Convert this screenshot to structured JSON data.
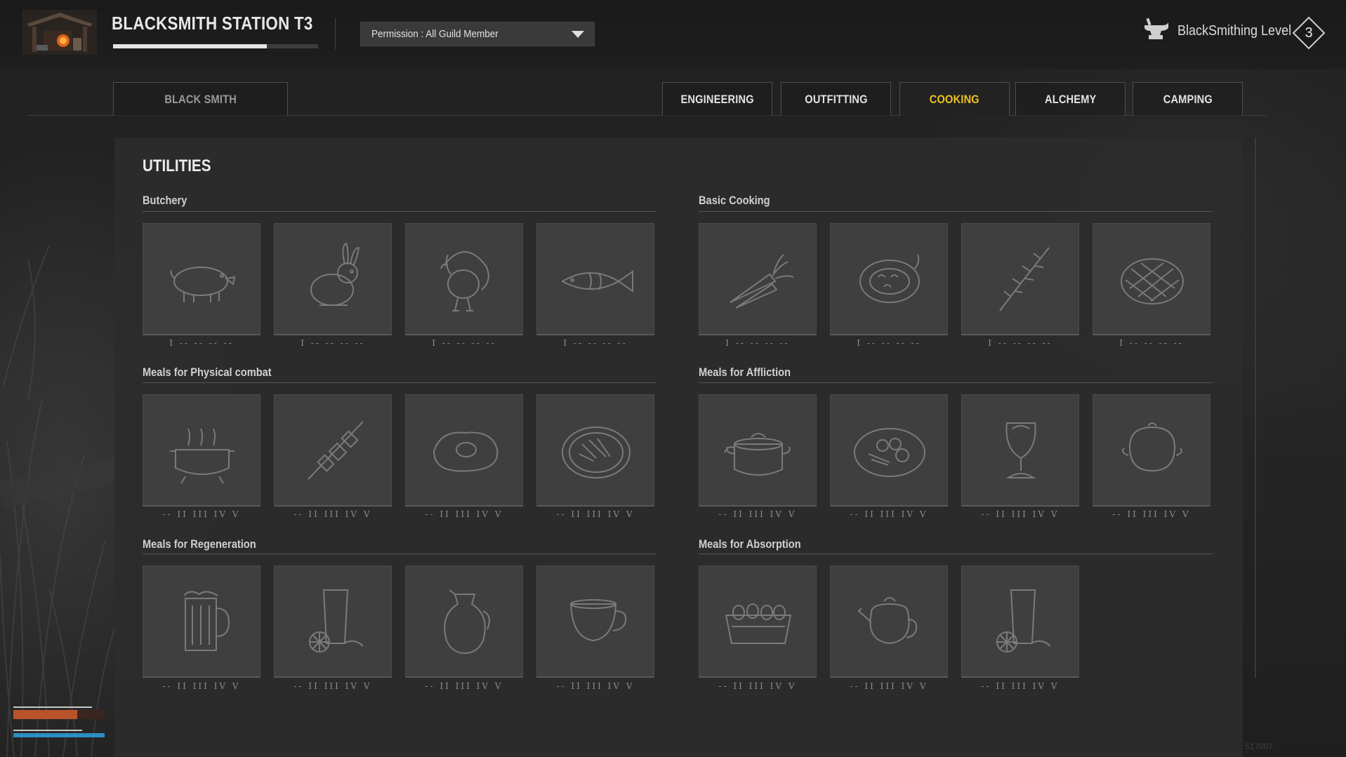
{
  "header": {
    "station_title": "BLACKSMITH STATION T3",
    "station_progress": 0.75,
    "permission_label": "Permission : All Guild Member",
    "level_label": "BlackSmithing Level",
    "level_value": "3"
  },
  "tabs": [
    {
      "label": "BLACK SMITH",
      "state": "dim"
    },
    {
      "label": "ENGINEERING",
      "state": "normal"
    },
    {
      "label": "OUTFITTING",
      "state": "normal"
    },
    {
      "label": "COOKING",
      "state": "active"
    },
    {
      "label": "ALCHEMY",
      "state": "normal"
    },
    {
      "label": "CAMPING",
      "state": "normal"
    }
  ],
  "panel": {
    "title": "UTILITIES",
    "sections": [
      {
        "title": "Butchery",
        "items": [
          {
            "icon": "pig-icon",
            "tiers": "I -- -- -- --"
          },
          {
            "icon": "rabbit-icon",
            "tiers": "I -- -- -- --"
          },
          {
            "icon": "turkey-icon",
            "tiers": "I -- -- -- --"
          },
          {
            "icon": "fish-icon",
            "tiers": "I -- -- -- --"
          }
        ]
      },
      {
        "title": "Basic Cooking",
        "items": [
          {
            "icon": "carrot-icon",
            "tiers": "I -- -- -- --"
          },
          {
            "icon": "tomato-icon",
            "tiers": "I -- -- -- --"
          },
          {
            "icon": "rosemary-icon",
            "tiers": "I -- -- -- --"
          },
          {
            "icon": "pie-icon",
            "tiers": "I -- -- -- --"
          }
        ]
      },
      {
        "title": "Meals for Physical combat",
        "items": [
          {
            "icon": "cooking-pot-icon",
            "tiers": "-- II III IV V"
          },
          {
            "icon": "skewer-icon",
            "tiers": "-- II III IV V"
          },
          {
            "icon": "fried-egg-icon",
            "tiers": "-- II III IV V"
          },
          {
            "icon": "salad-plate-icon",
            "tiers": "-- II III IV V"
          }
        ]
      },
      {
        "title": "Meals for Affliction",
        "items": [
          {
            "icon": "stew-pot-icon",
            "tiers": "-- II III IV V"
          },
          {
            "icon": "dish-plate-icon",
            "tiers": "-- II III IV V"
          },
          {
            "icon": "goblet-icon",
            "tiers": "-- II III IV V"
          },
          {
            "icon": "clay-pot-icon",
            "tiers": "-- II III IV V"
          }
        ]
      },
      {
        "title": "Meals for Regeneration",
        "items": [
          {
            "icon": "beer-mug-icon",
            "tiers": "-- II III IV V"
          },
          {
            "icon": "lemon-juice-icon",
            "tiers": "-- II III IV V"
          },
          {
            "icon": "pitcher-icon",
            "tiers": "-- II III IV V"
          },
          {
            "icon": "tea-cup-icon",
            "tiers": "-- II III IV V"
          }
        ]
      },
      {
        "title": "Meals for Absorption",
        "items": [
          {
            "icon": "egg-crate-icon",
            "tiers": "-- II III IV V"
          },
          {
            "icon": "teapot-icon",
            "tiers": "-- II III IV V"
          },
          {
            "icon": "lemon-juice-icon",
            "tiers": "-- II III IV V"
          }
        ]
      }
    ]
  },
  "status_bars": {
    "health_fraction": 0.7,
    "stamina_fraction": 1.0,
    "health_color": "#b9532a",
    "stamina_color": "#2a8fc4"
  },
  "watermark": "517007",
  "colors": {
    "active_tab": "#f0c020",
    "panel_bg": "#2c2c2c"
  }
}
